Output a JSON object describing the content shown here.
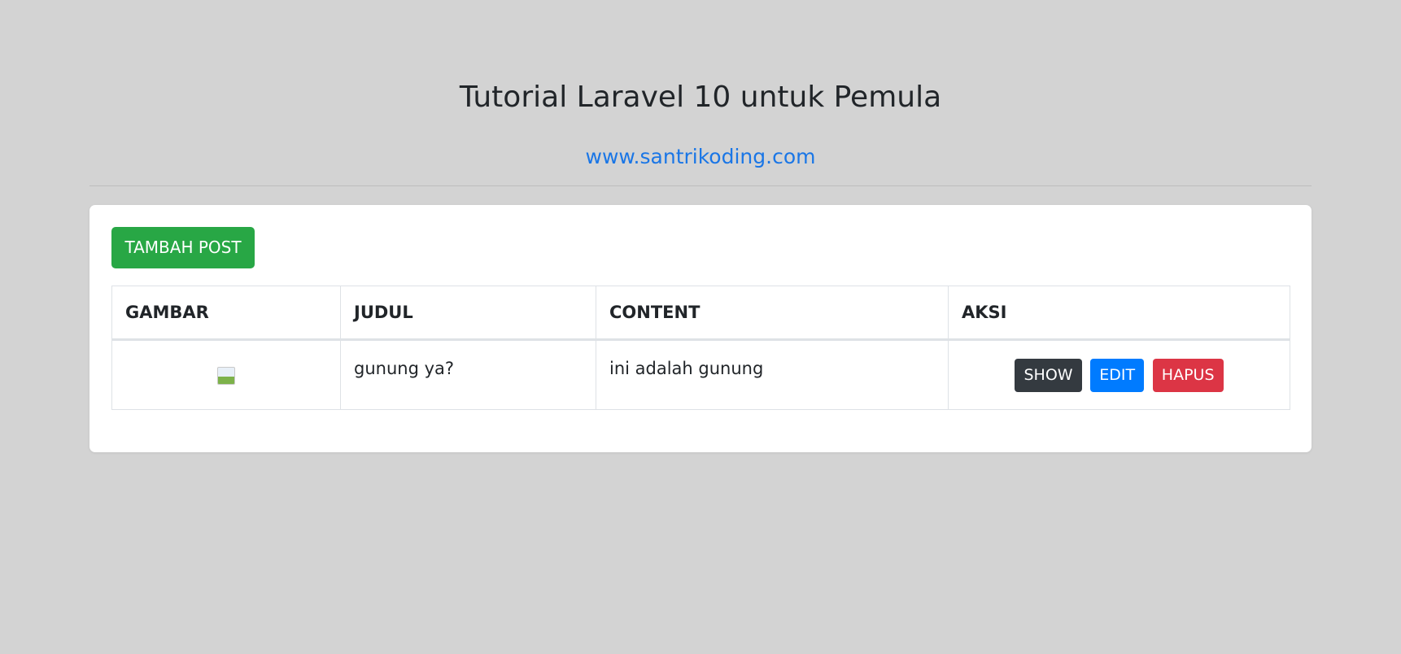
{
  "header": {
    "title": "Tutorial Laravel 10 untuk Pemula",
    "link": "www.santrikoding.com"
  },
  "toolbar": {
    "add_label": "TAMBAH POST"
  },
  "table": {
    "columns": [
      "GAMBAR",
      "JUDUL",
      "CONTENT",
      "AKSI"
    ],
    "rows": [
      {
        "judul": "gunung ya?",
        "content": "ini adalah gunung",
        "actions": {
          "show": "SHOW",
          "edit": "EDIT",
          "hapus": "HAPUS"
        }
      }
    ]
  },
  "colors": {
    "background": "#d3d3d3",
    "link": "#1a76e6",
    "add_button": "#28a745",
    "show_button": "#343a40",
    "edit_button": "#007bff",
    "hapus_button": "#dc3545"
  },
  "icons": {
    "broken_image": "broken-image-icon"
  }
}
